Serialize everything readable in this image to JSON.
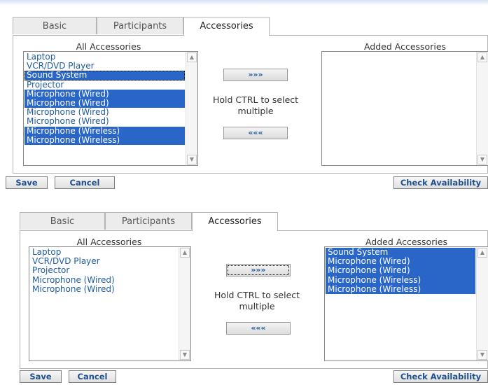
{
  "tabs": [
    "Basic",
    "Participants",
    "Accessories"
  ],
  "all_title": "All Accessories",
  "added_title": "Added Accessories",
  "add_label": "»»»",
  "remove_label": "«««",
  "hint_line1": "Hold CTRL to select",
  "hint_line2": "multiple",
  "save_label": "Save",
  "cancel_label": "Cancel",
  "check_label": "Check Availability",
  "panel1": {
    "all_items": [
      {
        "label": "Laptop",
        "selected": false
      },
      {
        "label": "VCR/DVD Player",
        "selected": false
      },
      {
        "label": "Sound System",
        "selected": true
      },
      {
        "label": "Projector",
        "selected": false
      },
      {
        "label": "Microphone (Wired)",
        "selected": true
      },
      {
        "label": "Microphone (Wired)",
        "selected": true
      },
      {
        "label": "Microphone (Wired)",
        "selected": false
      },
      {
        "label": "Microphone (Wired)",
        "selected": false
      },
      {
        "label": "Microphone (Wireless)",
        "selected": true
      },
      {
        "label": "Microphone (Wireless)",
        "selected": true
      }
    ],
    "added_items": []
  },
  "panel2": {
    "all_items": [
      {
        "label": "Laptop",
        "selected": false
      },
      {
        "label": "VCR/DVD Player",
        "selected": false
      },
      {
        "label": "Projector",
        "selected": false
      },
      {
        "label": "Microphone (Wired)",
        "selected": false
      },
      {
        "label": "Microphone (Wired)",
        "selected": false
      }
    ],
    "added_items": [
      {
        "label": "Sound System",
        "selected": true
      },
      {
        "label": "Microphone (Wired)",
        "selected": true
      },
      {
        "label": "Microphone (Wired)",
        "selected": true
      },
      {
        "label": "Microphone (Wireless)",
        "selected": true
      },
      {
        "label": "Microphone (Wireless)",
        "selected": true
      }
    ]
  },
  "icons": {
    "scroll_up": "scroll-up-arrow-icon",
    "scroll_down": "scroll-down-arrow-icon"
  }
}
